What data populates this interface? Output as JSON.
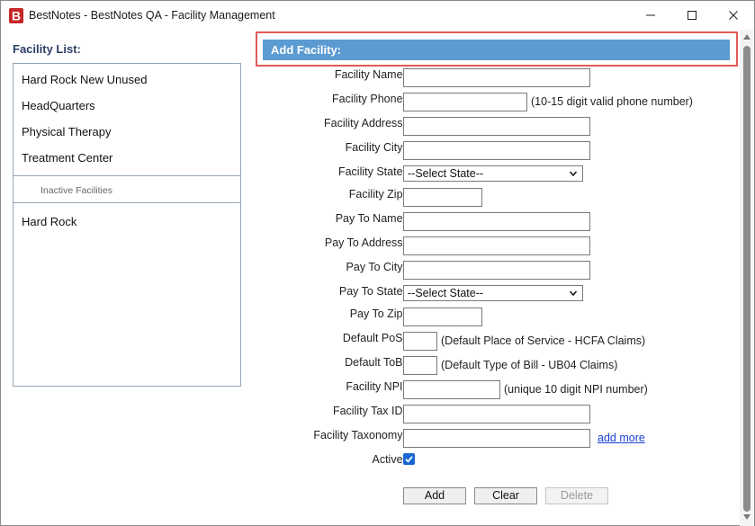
{
  "window": {
    "title": "BestNotes - BestNotes QA - Facility Management",
    "app_logo": "B",
    "controls": {
      "minimize_icon": "minimize-icon",
      "maximize_icon": "maximize-icon",
      "close_icon": "close-icon"
    }
  },
  "facility_list": {
    "label": "Facility List:",
    "active": [
      "Hard Rock New Unused",
      "HeadQuarters",
      "Physical Therapy",
      "Treatment Center"
    ],
    "inactive_label": "Inactive Facilities",
    "inactive": [
      "Hard Rock"
    ]
  },
  "form": {
    "header": "Add Facility:",
    "facility_name_label": "Facility Name:",
    "facility_phone_label": "Facility Phone:",
    "facility_phone_hint": "(10-15 digit valid phone number)",
    "facility_address_label": "Facility Address:",
    "facility_city_label": "Facility City:",
    "facility_state_label": "Facility State:",
    "facility_state_value": "--Select State--",
    "facility_zip_label": "Facility Zip:",
    "pay_to_name_label": "Pay To Name:",
    "pay_to_address_label": "Pay To Address:",
    "pay_to_city_label": "Pay To City:",
    "pay_to_state_label": "Pay To State:",
    "pay_to_state_value": "--Select State--",
    "pay_to_zip_label": "Pay To Zip:",
    "default_pos_label": "Default PoS:",
    "default_pos_hint": "(Default Place of Service - HCFA Claims)",
    "default_tob_label": "Default ToB:",
    "default_tob_hint": "(Default Type of Bill - UB04 Claims)",
    "facility_npi_label": "Facility NPI:",
    "facility_npi_hint": "(unique 10 digit NPI number)",
    "facility_tax_id_label": "Facility Tax ID:",
    "facility_taxonomy_label": "Facility Taxonomy:",
    "add_more_link": "add more",
    "active_label": "Active:",
    "active_checked": true
  },
  "buttons": {
    "add": "Add",
    "clear": "Clear",
    "delete": "Delete"
  },
  "colors": {
    "header_bar": "#5b9bd1",
    "highlight_border": "#e25a5a",
    "logo": "#c62828",
    "checkbox": "#1a66d4"
  }
}
